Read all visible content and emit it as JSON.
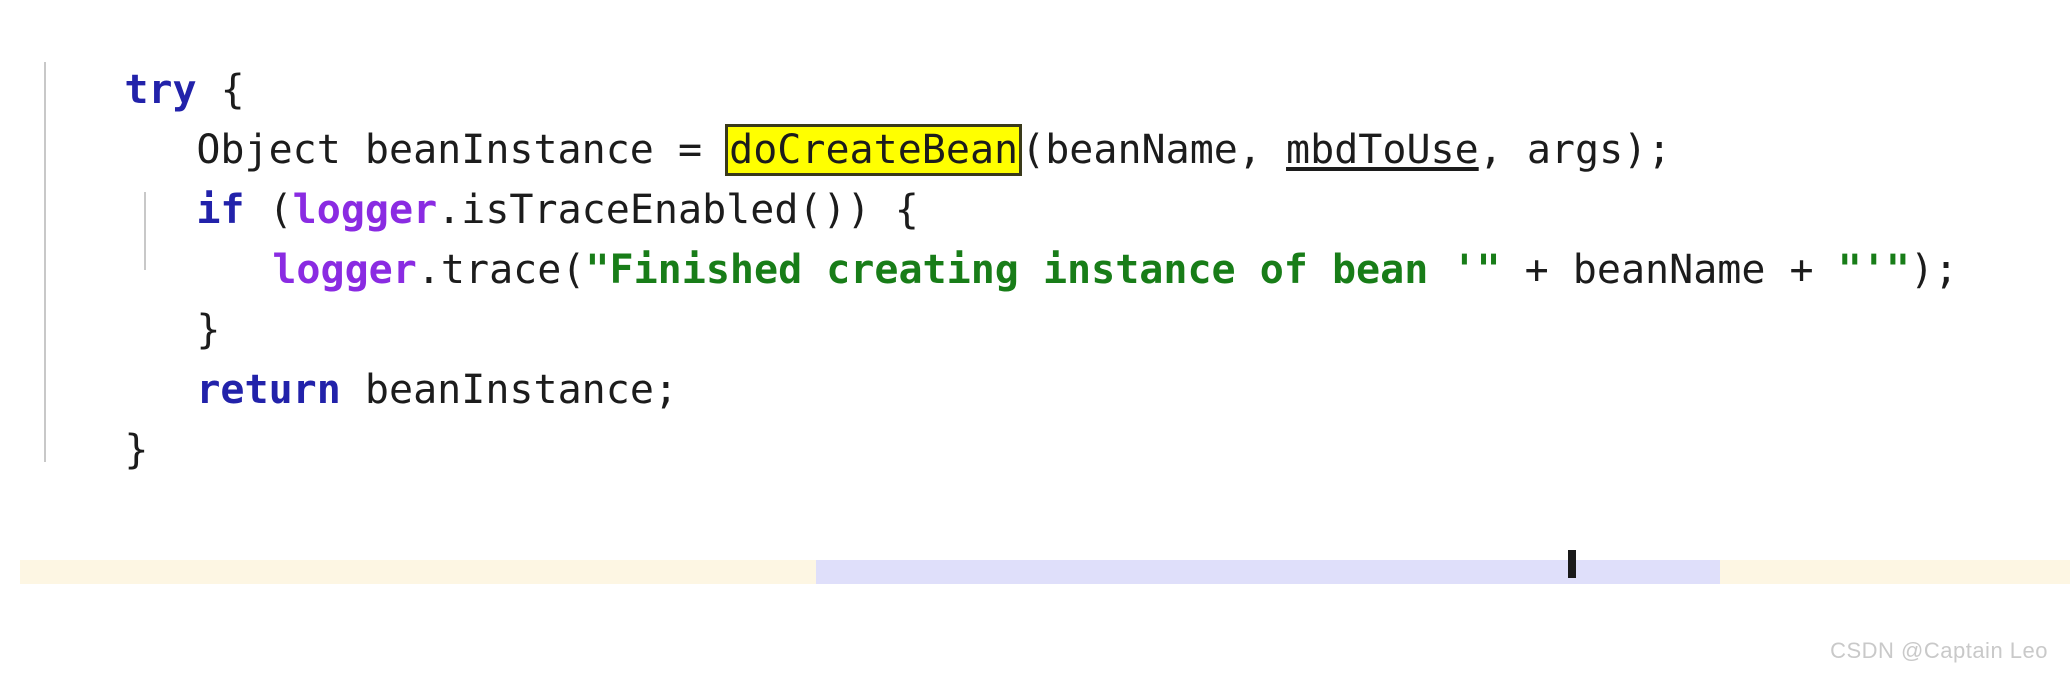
{
  "editor": {
    "language": "java",
    "colors": {
      "keyword": "#2222aa",
      "field": "#8a2be2",
      "string": "#187d18",
      "plain": "#1c1c1c",
      "highlight_background": "#ffff00",
      "highlight_border": "#3a3a1a",
      "indent_guide": "#c8c8c8",
      "background": "#ffffff"
    },
    "lines": [
      {
        "indent": 0,
        "tokens": [
          {
            "text": "try",
            "kind": "keyword"
          },
          {
            "text": " {",
            "kind": "plain"
          }
        ]
      },
      {
        "indent": 1,
        "tokens": [
          {
            "text": "Object beanInstance = ",
            "kind": "plain"
          },
          {
            "text": "doCreateBean",
            "kind": "highlight"
          },
          {
            "text": "(beanName, ",
            "kind": "plain"
          },
          {
            "text": "mbdToUse",
            "kind": "underline"
          },
          {
            "text": ", args);",
            "kind": "plain"
          }
        ]
      },
      {
        "indent": 1,
        "tokens": [
          {
            "text": "if",
            "kind": "keyword"
          },
          {
            "text": " (",
            "kind": "plain"
          },
          {
            "text": "logger",
            "kind": "field"
          },
          {
            "text": ".isTraceEnabled()) {",
            "kind": "plain"
          }
        ]
      },
      {
        "indent": 2,
        "tokens": [
          {
            "text": "logger",
            "kind": "field"
          },
          {
            "text": ".trace(",
            "kind": "plain"
          },
          {
            "text": "\"Finished creating instance of bean '\"",
            "kind": "string"
          },
          {
            "text": " + beanName + ",
            "kind": "plain"
          },
          {
            "text": "\"'\"",
            "kind": "string"
          },
          {
            "text": ");",
            "kind": "plain"
          }
        ]
      },
      {
        "indent": 1,
        "tokens": [
          {
            "text": "}",
            "kind": "plain"
          }
        ]
      },
      {
        "indent": 1,
        "tokens": [
          {
            "text": "return",
            "kind": "keyword"
          },
          {
            "text": " beanInstance;",
            "kind": "plain"
          }
        ]
      },
      {
        "indent": 0,
        "tokens": [
          {
            "text": "}",
            "kind": "plain"
          }
        ]
      }
    ],
    "highlighted_symbol": "doCreateBean"
  },
  "bottom_bars": [
    {
      "name": "cream-left",
      "color": "#fdf6e3"
    },
    {
      "name": "lavender",
      "color": "#dfdffa"
    },
    {
      "name": "cream-right",
      "color": "#fdf6e3"
    }
  ],
  "watermark": {
    "text": "CSDN @Captain Leo"
  }
}
